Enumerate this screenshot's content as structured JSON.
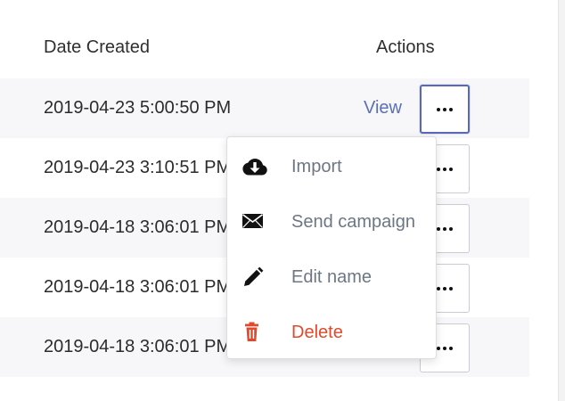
{
  "table": {
    "headers": {
      "date_created": "Date Created",
      "actions": "Actions"
    },
    "rows": [
      {
        "date": "2019-04-23 5:00:50 PM",
        "view_label": "View"
      },
      {
        "date": "2019-04-23 3:10:51 PM",
        "view_label": ""
      },
      {
        "date": "2019-04-18 3:06:01 PM",
        "view_label": ""
      },
      {
        "date": "2019-04-18 3:06:01 PM",
        "view_label": ""
      },
      {
        "date": "2019-04-18 3:06:01 PM",
        "view_label": ""
      }
    ]
  },
  "menu": {
    "items": [
      {
        "label": "Import",
        "icon": "cloud-download-icon"
      },
      {
        "label": "Send campaign",
        "icon": "envelope-icon"
      },
      {
        "label": "Edit name",
        "icon": "pencil-icon"
      },
      {
        "label": "Delete",
        "icon": "trash-icon"
      }
    ]
  },
  "colors": {
    "link": "#5a6fb8",
    "danger": "#e0492b",
    "active_border": "#5a68b8",
    "muted_text": "#6c7685"
  }
}
